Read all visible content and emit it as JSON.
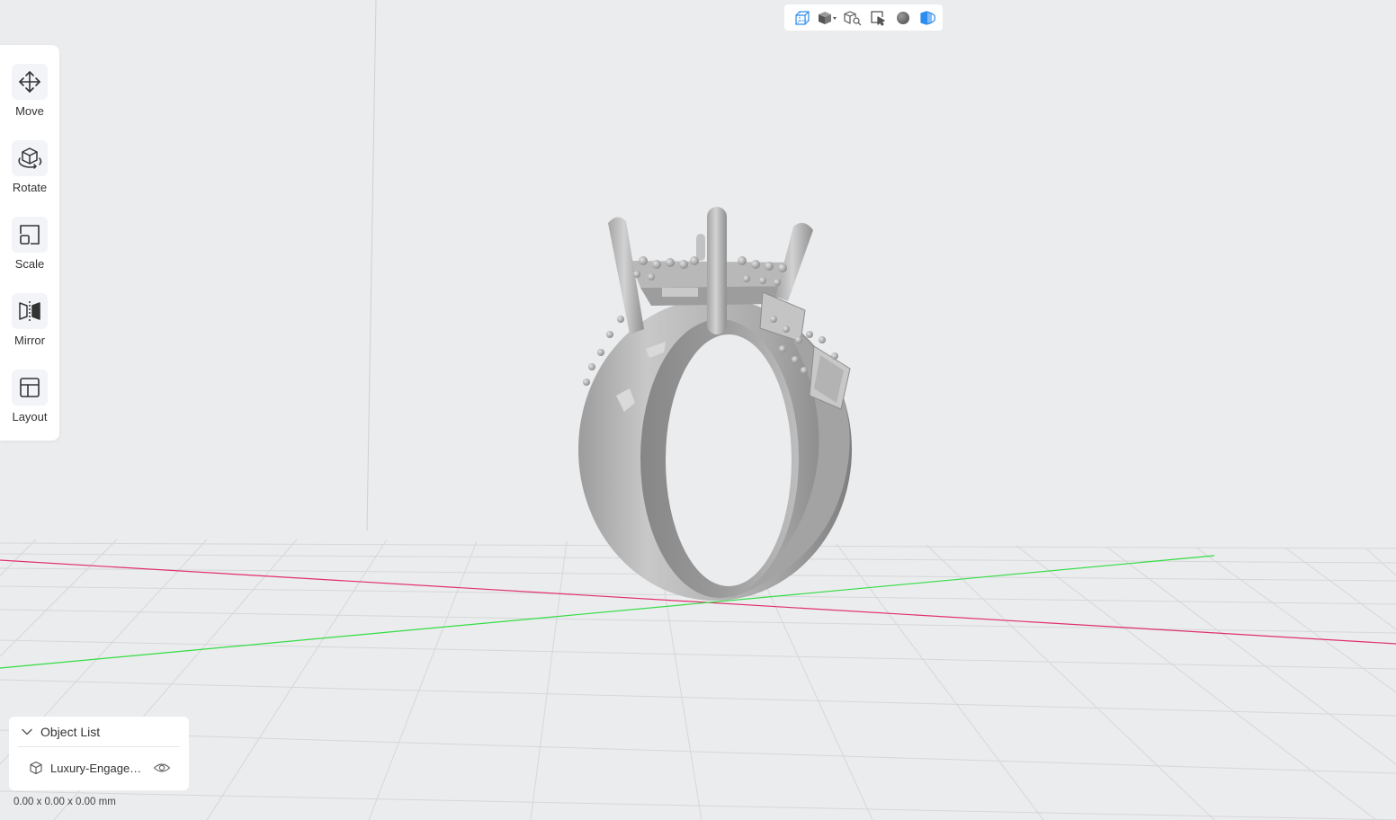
{
  "tools": [
    {
      "id": "move",
      "label": "Move",
      "icon": "move-arrows-icon"
    },
    {
      "id": "rotate",
      "label": "Rotate",
      "icon": "rotate-cube-icon"
    },
    {
      "id": "scale",
      "label": "Scale",
      "icon": "scale-icon"
    },
    {
      "id": "mirror",
      "label": "Mirror",
      "icon": "mirror-icon"
    },
    {
      "id": "layout",
      "label": "Layout",
      "icon": "layout-icon"
    }
  ],
  "view_toolbar": [
    {
      "icon": "wireframe-cube-icon",
      "color": "#2d8cf0"
    },
    {
      "icon": "solid-cube-dropdown-icon",
      "color": "#555555"
    },
    {
      "icon": "cube-search-icon",
      "color": "#555555"
    },
    {
      "icon": "select-cursor-icon",
      "color": "#555555"
    },
    {
      "icon": "sphere-shading-icon",
      "color": "#666666"
    },
    {
      "icon": "slice-preview-icon",
      "color": "#2d8cf0"
    }
  ],
  "object_list": {
    "title": "Object List",
    "items": [
      {
        "name": "Luxury-Engagement-Ring",
        "icon": "cube-outline-icon",
        "visible": true
      }
    ]
  },
  "dimensions": "0.00 x 0.00 x 0.00 mm",
  "colors": {
    "background": "#ebecee",
    "grid": "#d6d7d9",
    "x_axis": "#e0306a",
    "y_axis": "#33dd44",
    "accent": "#2d8cf0",
    "model": "#b3b3b3"
  }
}
